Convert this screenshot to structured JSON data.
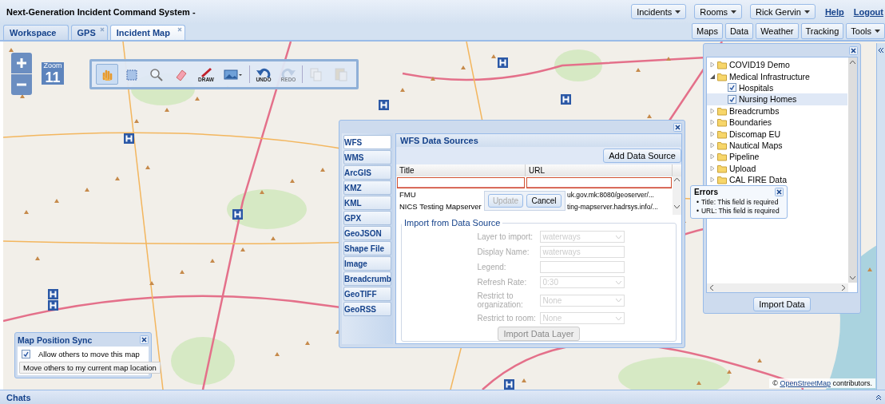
{
  "window": {
    "title": "Next-Generation Incident Command System -"
  },
  "header_menus": [
    {
      "label": "Incidents"
    },
    {
      "label": "Rooms"
    },
    {
      "label": "Rick Gervin"
    }
  ],
  "header_links": [
    "Help",
    "Logout"
  ],
  "tabs": [
    {
      "label": "Workspace",
      "selected": false,
      "closable": false
    },
    {
      "label": "GPS",
      "selected": false,
      "closable": true
    },
    {
      "label": "Incident Map",
      "selected": true,
      "closable": true
    }
  ],
  "map_buttons": [
    {
      "label": "Maps",
      "menu": false
    },
    {
      "label": "Data",
      "menu": false
    },
    {
      "label": "Weather",
      "menu": false
    },
    {
      "label": "Tracking",
      "menu": false
    },
    {
      "label": "Tools",
      "menu": true
    }
  ],
  "map": {
    "zoom_label": "Zoom",
    "attribution_prefix": "©",
    "zoom_level": "11",
    "attribution_link": "OpenStreetMap",
    "attribution_text": "contributors."
  },
  "map_toolbar": [
    {
      "kind": "pan",
      "selected": true,
      "disabled": false
    },
    {
      "kind": "select",
      "selected": false,
      "disabled": false
    },
    {
      "kind": "zoom",
      "selected": false,
      "disabled": false
    },
    {
      "kind": "erase",
      "selected": false,
      "disabled": false
    },
    {
      "kind": "draw",
      "label": "DRAW",
      "selected": false,
      "disabled": false
    },
    {
      "kind": "image",
      "selected": false,
      "disabled": false
    },
    {
      "kind": "undo",
      "label": "UNDO",
      "selected": false,
      "disabled": false
    },
    {
      "kind": "redo",
      "label": "REDO",
      "selected": false,
      "disabled": true
    },
    {
      "kind": "copy",
      "selected": false,
      "disabled": true
    },
    {
      "kind": "paste",
      "selected": false,
      "disabled": true
    }
  ],
  "data_dialog": {
    "sources": [
      {
        "label": "WFS",
        "selected": true
      },
      {
        "label": "WMS",
        "selected": false
      },
      {
        "label": "ArcGIS",
        "selected": false
      },
      {
        "label": "KMZ",
        "selected": false
      },
      {
        "label": "KML",
        "selected": false
      },
      {
        "label": "GPX",
        "selected": false
      },
      {
        "label": "GeoJSON",
        "selected": false
      },
      {
        "label": "Shape File",
        "selected": false
      },
      {
        "label": "Image",
        "selected": false
      },
      {
        "label": "Breadcrumb",
        "selected": false
      },
      {
        "label": "GeoTIFF",
        "selected": false
      },
      {
        "label": "GeoRSS",
        "selected": false
      }
    ],
    "title": "WFS Data Sources",
    "add_button": "Add Data Source",
    "columns": [
      "Title",
      "URL"
    ],
    "editor_cells": [
      {
        "invalid": true
      },
      {
        "invalid": true
      }
    ],
    "rows": [
      {
        "title": "FMU",
        "url": "uk.gov.mk:8080/geoserver/..."
      },
      {
        "title": "NICS Testing Mapserver",
        "url": "ting-mapserver.hadrsys.info/..."
      }
    ],
    "editor_buttons": [
      {
        "label": "Update",
        "disabled": true
      },
      {
        "label": "Cancel",
        "disabled": false
      }
    ],
    "import_legend": "Import from Data Source",
    "fields": [
      {
        "label": "Layer to import:",
        "kind": "select",
        "value": "waterways",
        "disabled": true
      },
      {
        "label": "Display Name:",
        "kind": "text",
        "value": "waterways",
        "disabled": true
      },
      {
        "label": "Legend:",
        "kind": "text",
        "disabled": true
      },
      {
        "label": "Refresh Rate:",
        "kind": "select",
        "value": "0:30",
        "disabled": true
      },
      {
        "label": "Restrict to organization:",
        "kind": "select",
        "value": "None",
        "disabled": true
      },
      {
        "label": "Restrict to room:",
        "kind": "select",
        "value": "None",
        "disabled": true
      }
    ],
    "import_button": {
      "label": "Import Data Layer",
      "disabled": true
    }
  },
  "layer_tree": [
    {
      "label": "COVID19 Demo",
      "expanded": false,
      "selected": false
    },
    {
      "label": "Medical Infrastructure",
      "expanded": true,
      "selected": false,
      "children": [
        {
          "label": "Hospitals",
          "checked": true,
          "selected": false
        },
        {
          "label": "Nursing Homes",
          "checked": true,
          "selected": true
        }
      ]
    },
    {
      "label": "Breadcrumbs",
      "expanded": false,
      "selected": false
    },
    {
      "label": "Boundaries",
      "expanded": false,
      "selected": false
    },
    {
      "label": "Discomap EU",
      "expanded": false,
      "selected": false
    },
    {
      "label": "Nautical Maps",
      "expanded": false,
      "selected": false
    },
    {
      "label": "Pipeline",
      "expanded": false,
      "selected": false
    },
    {
      "label": "Upload",
      "expanded": false,
      "selected": false
    },
    {
      "label": "CAL FIRE Data",
      "expanded": false,
      "selected": false
    }
  ],
  "layer_panel": {
    "import_button": "Import Data"
  },
  "errors": {
    "title": "Errors",
    "bullet": "•",
    "items": [
      "Title: This field is required",
      "URL: This field is required"
    ]
  },
  "map_sync": {
    "title": "Map Position Sync",
    "allow_label": "Allow others to move this map",
    "allow_checked": true,
    "move_button": "Move others to my current map location"
  },
  "chats": {
    "title": "Chats"
  }
}
